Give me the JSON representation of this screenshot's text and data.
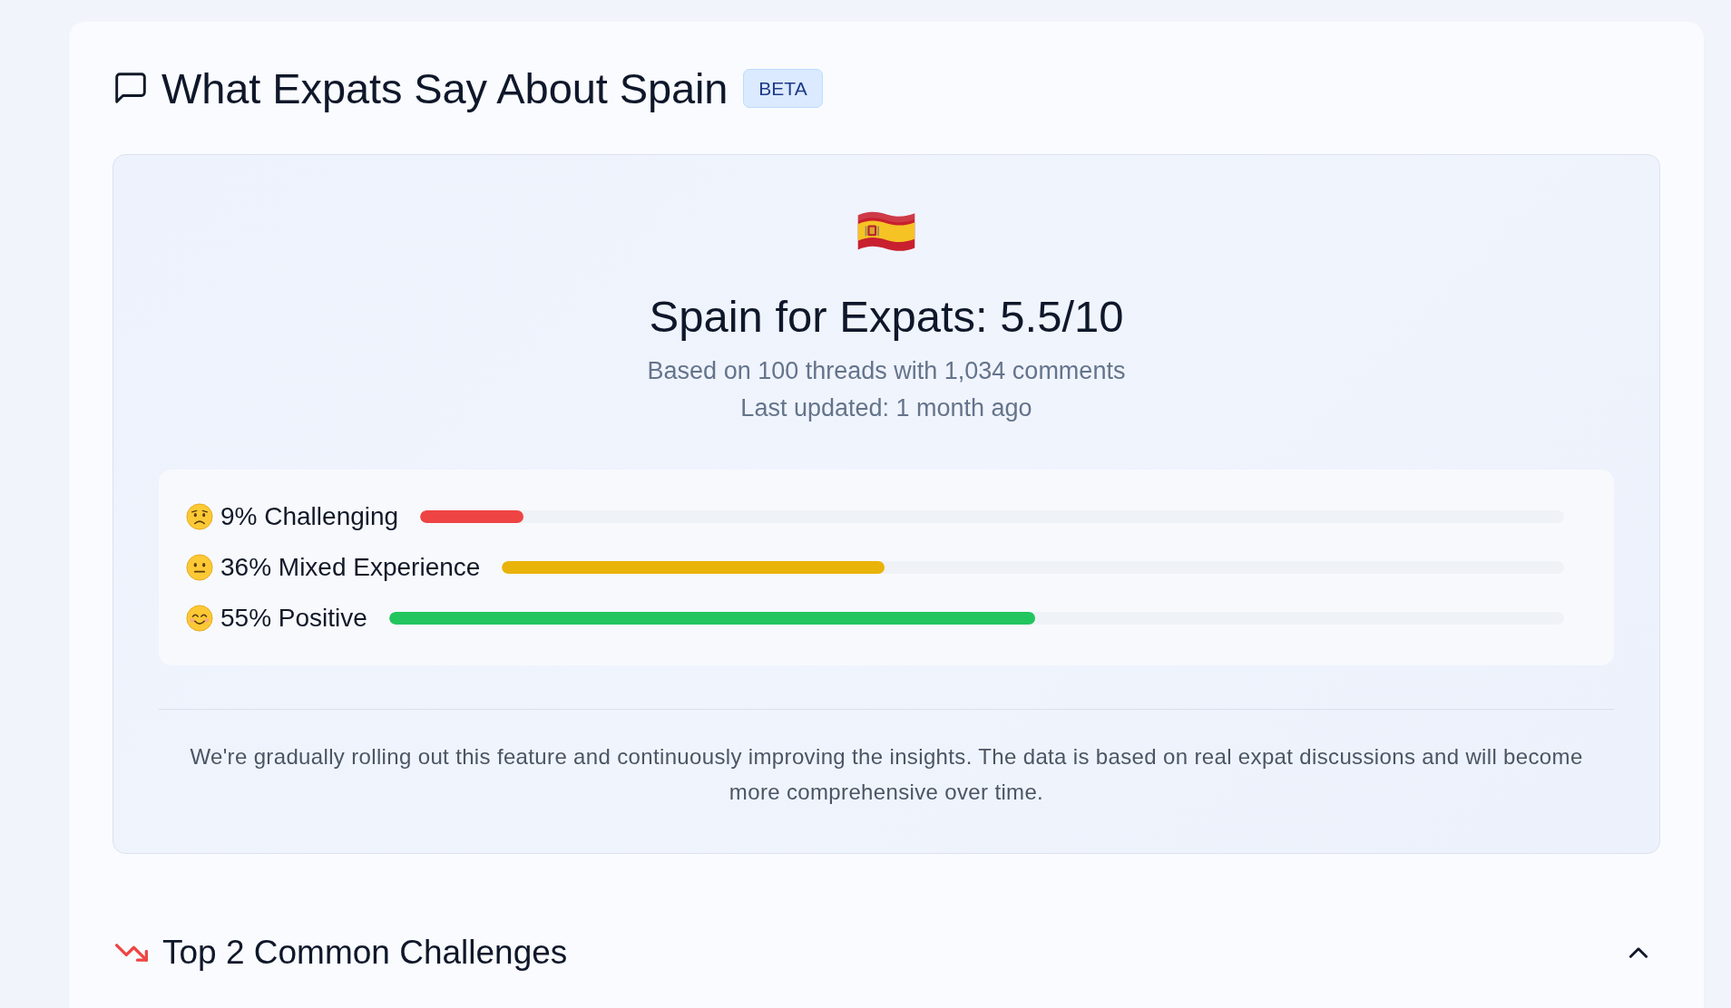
{
  "section": {
    "title": "What Expats Say About Spain",
    "badge": "BETA"
  },
  "summary": {
    "title": "Spain for Expats: 5.5/10",
    "subtitle": "Based on 100 threads with 1,034 comments",
    "updated": "Last updated: 1 month ago",
    "sentiments": [
      {
        "kind": "negative",
        "label": "9% Challenging",
        "level": 0.09,
        "color": "#ef4444"
      },
      {
        "kind": "neutral",
        "label": "36% Mixed Experience",
        "level": 0.36,
        "color": "#eab308"
      },
      {
        "kind": "positive",
        "label": "55% Positive",
        "level": 0.55,
        "color": "#22c55e"
      }
    ],
    "note": "We're gradually rolling out this feature and continuously improving the insights. The data is based on real expat discussions and will become more comprehensive over time."
  },
  "challenges": {
    "title": "Top 2 Common Challenges",
    "expanded": true
  }
}
